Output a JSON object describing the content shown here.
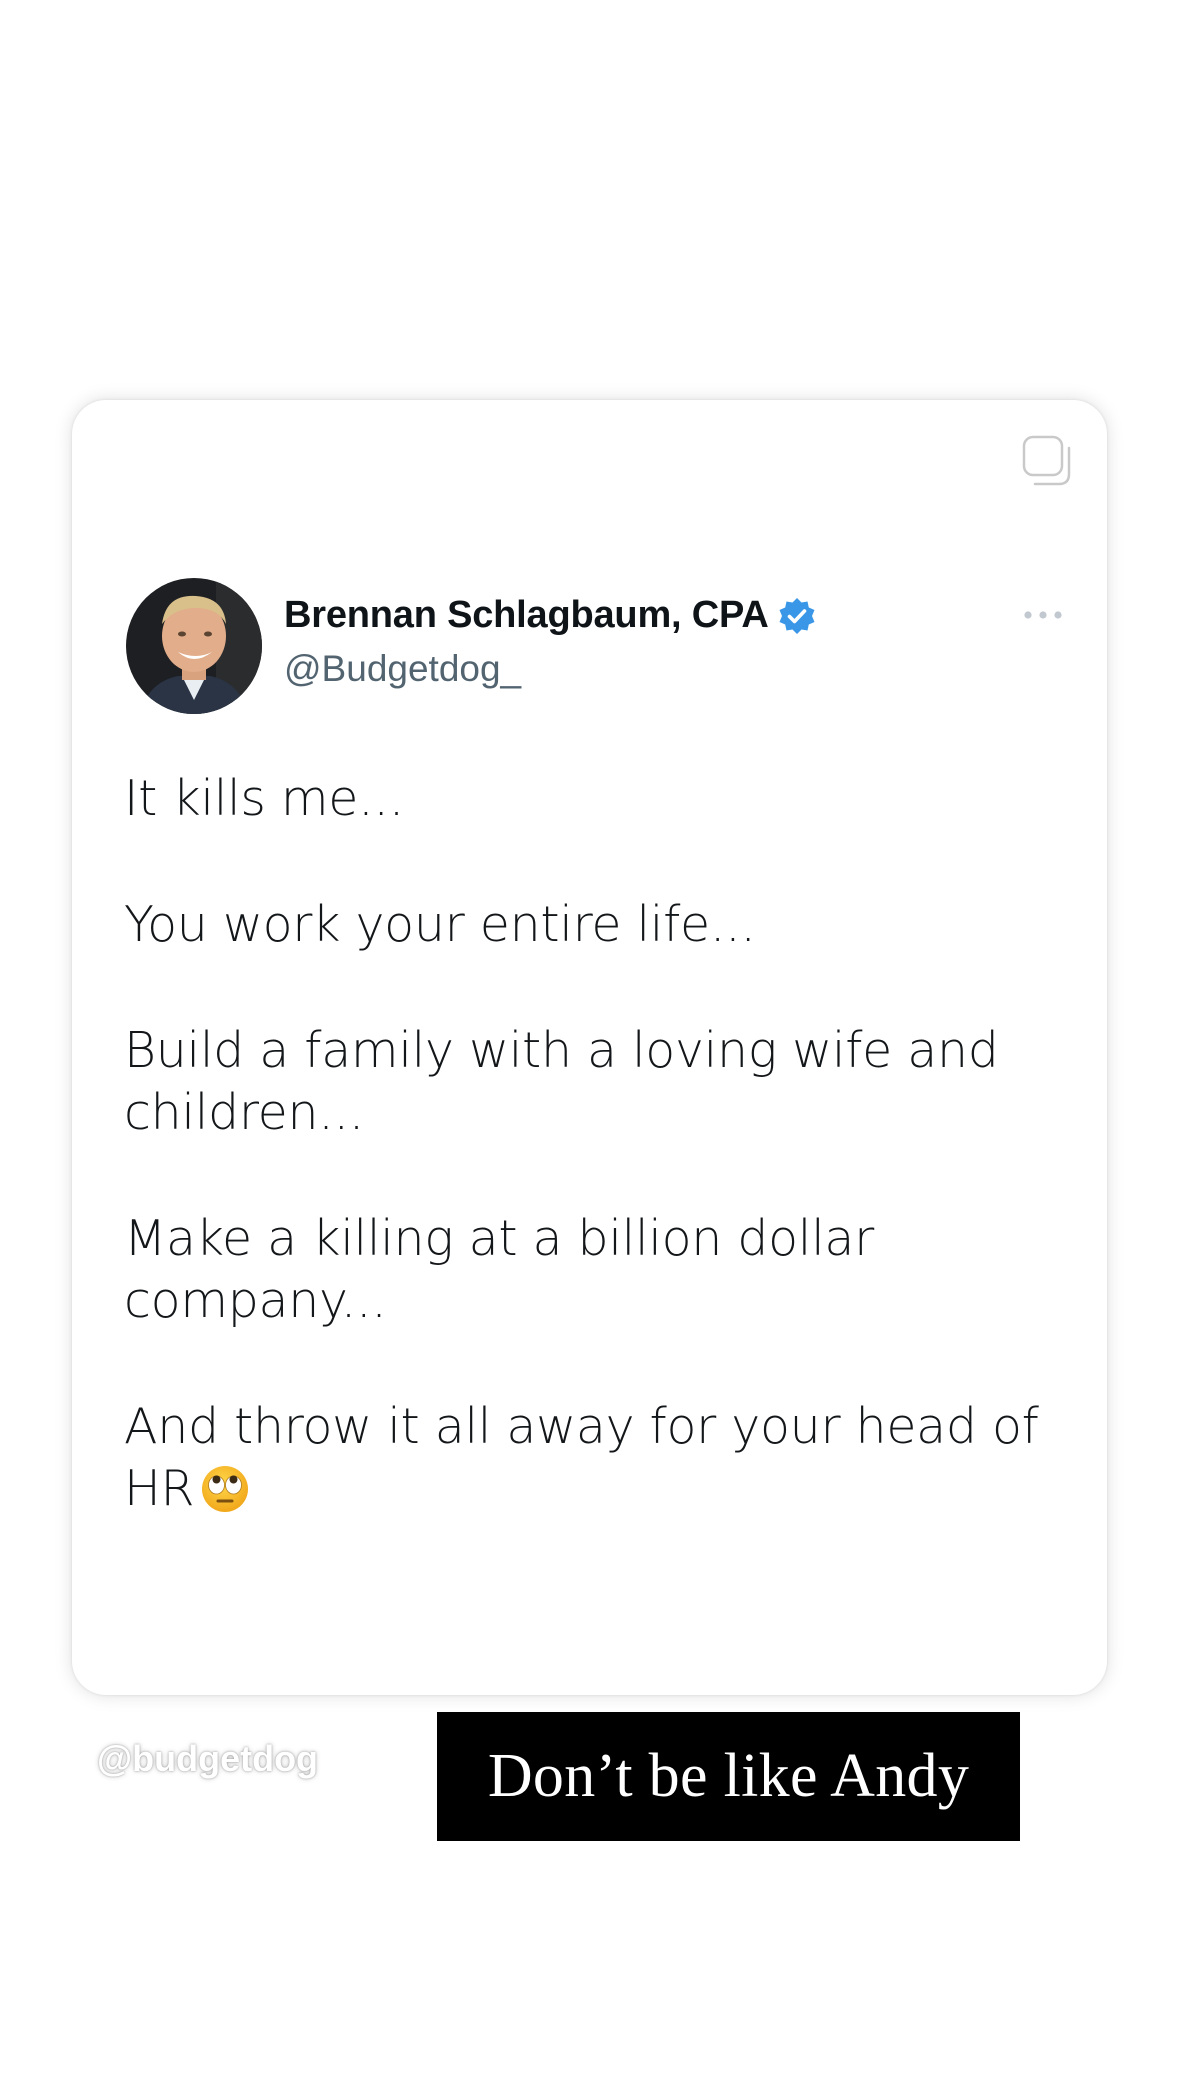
{
  "tweet": {
    "display_name": "Brennan Schlagbaum, CPA",
    "handle": "@Budgetdog_",
    "verified": true,
    "verified_color": "#3a97e8",
    "avatar_icon": "profile-photo",
    "menu_icon": "more-horizontal-icon",
    "copy_icon": "copy-icon",
    "paragraphs": [
      "It kills me...",
      "You work your entire life...",
      "Build a family with a loving wife and children...",
      "Make a killing at a billion dollar company...",
      "And throw it all away for your head of HR"
    ],
    "trailing_emoji": "face-with-rolling-eyes"
  },
  "watermark": "@budgetdog",
  "caption": {
    "text": "Don’t be like Andy",
    "background": "#000000",
    "color": "#ffffff"
  }
}
